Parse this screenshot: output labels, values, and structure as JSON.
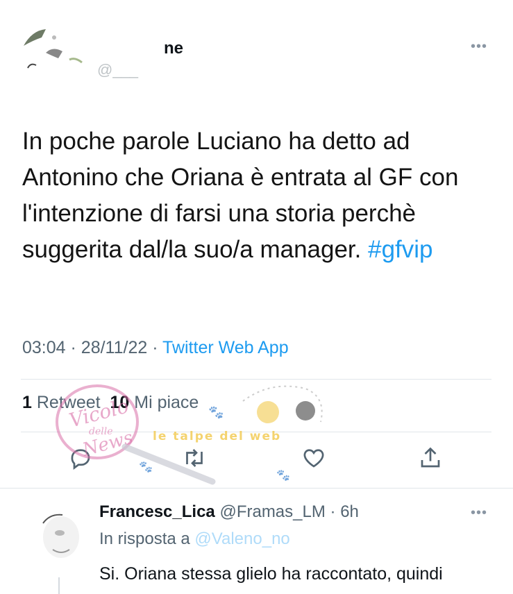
{
  "tweet": {
    "author_name": "ne",
    "author_handle": "@___",
    "text": "In poche parole Luciano ha detto ad Antonino che Oriana è entrata al GF con l'intenzione di farsi una storia perchè suggerita dal/la suo/a manager.",
    "hashtag": "#gfvip",
    "time": "03:04",
    "separator": "·",
    "date": "28/11/22",
    "source": "Twitter Web App",
    "retweets_count": "1",
    "retweets_label": "Retweet",
    "likes_count": "10",
    "likes_label": "Mi piace",
    "more_icon": "more-horizontal-icon",
    "actions": [
      "reply-icon",
      "retweet-icon",
      "like-icon",
      "share-icon"
    ]
  },
  "reply": {
    "author_name": "Francesc_Lica",
    "author_handle": "@Framas_LM",
    "separator": "·",
    "time": "6h",
    "reply_to_label": "In risposta a",
    "reply_to_mention": "@Valeno_no",
    "text": "Si. Oriana stessa glielo ha raccontato, quindi",
    "more_icon": "more-horizontal-icon"
  },
  "watermark": {
    "logo_text_1": "Vicolo",
    "logo_text_2": "delle",
    "logo_text_3": "News",
    "banner_text": "le talpe del web"
  },
  "colors": {
    "accent": "#1d9bf0",
    "secondary_text": "#536471",
    "watermark_pink": "#d96fa8",
    "watermark_yellow": "#f2c94c"
  }
}
